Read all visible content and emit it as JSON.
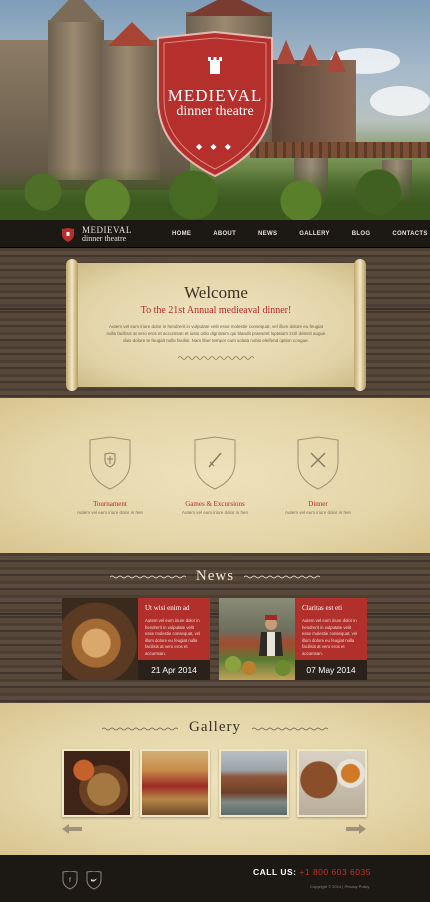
{
  "hero": {
    "badge_title": "MEDIEVAL",
    "badge_subtitle": "dinner theatre",
    "badge_dots": "◆ ◆ ◆"
  },
  "nav": {
    "logo_line1": "MEDIEVAL",
    "logo_line2": "dinner theatre",
    "items": [
      "HOME",
      "ABOUT",
      "NEWS",
      "GALLERY",
      "BLOG",
      "CONTACTS"
    ]
  },
  "welcome": {
    "title": "Welcome",
    "subtitle": "To the 21st Annual medieaval dinner!",
    "body": "Autem vel eum iriure dolor in hendrerit in vulputate velit esse molestie consequat, vel illum dolore eu feugiat nulla facilisis at vero eros et accumsan et iusto odio dignissim qui blandit praesent luptatum zzril delenit augue duis dolore te feugait nulla facilisi. Nam liber tempor cum soluta nobis eleifend option congue."
  },
  "features": [
    {
      "title": "Tournament",
      "text": "Autem vel eum iriure dolor in hen",
      "icon": "shield-cross-icon"
    },
    {
      "title": "Games & Excursions",
      "text": "Autem vel eum iriure dolor in hen",
      "icon": "sword-icon"
    },
    {
      "title": "Dinner",
      "text": "Autem vel eum iriure dolor in hen",
      "icon": "crossed-utensils-icon"
    }
  ],
  "news": {
    "title": "News",
    "items": [
      {
        "title": "Ut wisi enim ad",
        "text": "Autem vel eum iriure dolor in hendrerit in vulputate velit esse molestie consequat, vel illum dolore eu feugiat nulla facilisis at vero eros et accumsan.",
        "date": "21 Apr 2014"
      },
      {
        "title": "Claritas est eti",
        "text": "Autem vel eum iriure dolor in hendrerit in vulputate velit esse molestie consequat, vel illum dolore eu feugiat nulla facilisis at vero eros et accumsan.",
        "date": "07 May 2014"
      }
    ]
  },
  "gallery": {
    "title": "Gallery"
  },
  "footer": {
    "call_label": "CALL US:",
    "phone": "+1 800 603 6035",
    "copyright": "Copyright © 2014 | Privacy Policy",
    "social": [
      "facebook-icon",
      "twitter-icon"
    ]
  },
  "colors": {
    "accent": "#b22b27",
    "dark": "#1c1814",
    "parchment": "#e8dcb6"
  }
}
